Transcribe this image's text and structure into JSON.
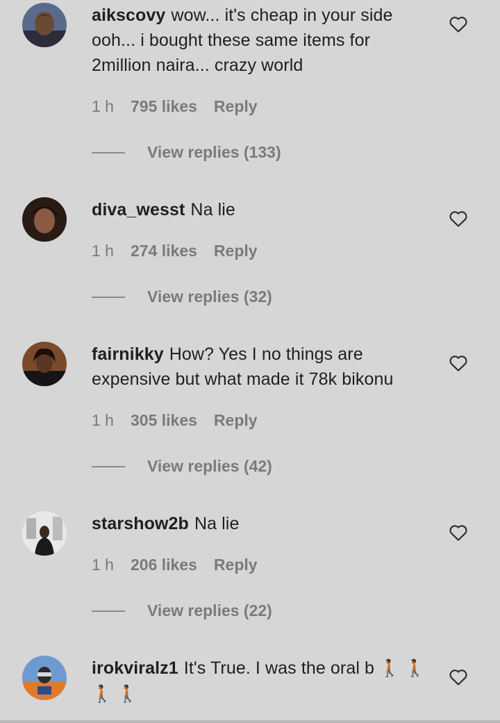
{
  "comments": [
    {
      "username": "aikscovy",
      "text": "wow... it's cheap in your side ooh... i bought these same items for 2million naira... crazy world",
      "time": "1 h",
      "likes": "795 likes",
      "reply": "Reply",
      "view_replies": "View replies (133)"
    },
    {
      "username": "diva_wesst",
      "text": "Na lie",
      "time": "1 h",
      "likes": "274 likes",
      "reply": "Reply",
      "view_replies": "View replies (32)"
    },
    {
      "username": "fairnikky",
      "text": "How? Yes I no things are expensive but what made it 78k bikonu",
      "time": "1 h",
      "likes": "305 likes",
      "reply": "Reply",
      "view_replies": "View replies (42)"
    },
    {
      "username": "starshow2b",
      "text": "Na lie",
      "time": "1 h",
      "likes": "206 likes",
      "reply": "Reply",
      "view_replies": "View replies (22)"
    },
    {
      "username": "irokviralz1",
      "text": "It's True. I was the oral b",
      "emoji_trail": "🚶🏾 🚶🏾 🚶🏾 🚶🏾"
    }
  ],
  "icons": {
    "like": "heart-outline-icon",
    "walking": "person-walking-emoji"
  },
  "colors": {
    "background": "#d6d6d6",
    "text": "#1f1f1f",
    "muted": "#7a7a7a"
  }
}
